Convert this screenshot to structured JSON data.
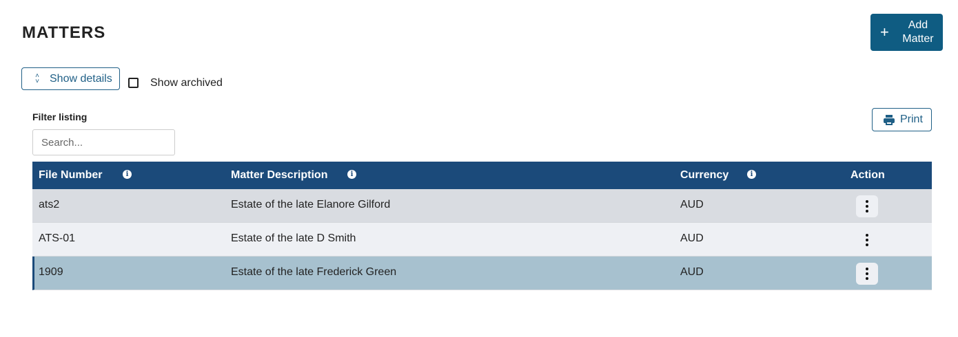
{
  "header": {
    "title": "MATTERS",
    "add_label": "Add\nMatter",
    "add_icon": "plus-icon"
  },
  "controls": {
    "show_details_label": "Show details",
    "show_details_icon": "chevron-up-down-icon",
    "show_archived_label": "Show archived",
    "show_archived_checked": false
  },
  "filter": {
    "label": "Filter listing",
    "placeholder": "Search...",
    "value": ""
  },
  "print": {
    "label": "Print",
    "icon": "printer-icon"
  },
  "table": {
    "columns": [
      {
        "label": "File Number",
        "info": true
      },
      {
        "label": "Matter Description",
        "info": true
      },
      {
        "label": "Currency",
        "info": true
      },
      {
        "label": "Action",
        "info": false
      }
    ],
    "rows": [
      {
        "file_number": "ats2",
        "description": "Estate of the late Elanore Gilford",
        "currency": "AUD"
      },
      {
        "file_number": "ATS-01",
        "description": "Estate of the late D Smith",
        "currency": "AUD"
      },
      {
        "file_number": "1909",
        "description": "Estate of the late Frederick Green",
        "currency": "AUD",
        "selected": true
      }
    ]
  },
  "colors": {
    "primary": "#0f5c82",
    "header_bg": "#1b4a7a",
    "selected_row": "#a7c1cf"
  }
}
